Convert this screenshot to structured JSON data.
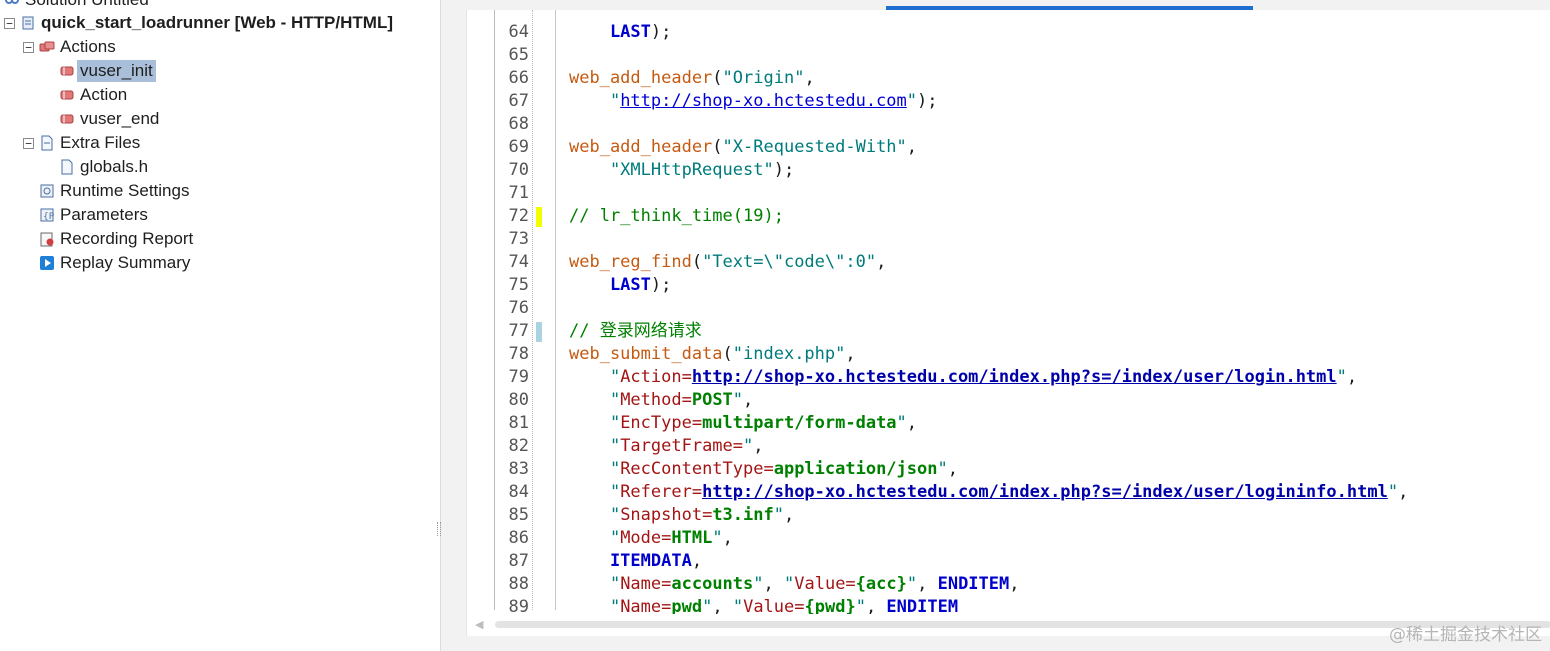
{
  "explorer": {
    "solution_label": "Solution Untitled",
    "script_label": "quick_start_loadrunner [Web - HTTP/HTML]",
    "actions_label": "Actions",
    "vuser_init_label": "vuser_init",
    "action_label": "Action",
    "vuser_end_label": "vuser_end",
    "extra_files_label": "Extra Files",
    "globals_label": "globals.h",
    "runtime_settings_label": "Runtime Settings",
    "parameters_label": "Parameters",
    "recording_report_label": "Recording Report",
    "replay_summary_label": "Replay Summary",
    "toggle_collapse_glyph": "−"
  },
  "editor": {
    "lines": [
      {
        "num": "64",
        "marker": "",
        "segments": [
          {
            "cls": "k-const",
            "text": "    LAST"
          },
          {
            "cls": "k-pun",
            "text": ");"
          }
        ]
      },
      {
        "num": "65",
        "marker": "",
        "segments": []
      },
      {
        "num": "66",
        "marker": "",
        "segments": [
          {
            "cls": "k-fn",
            "text": "web_add_header"
          },
          {
            "cls": "k-pun",
            "text": "("
          },
          {
            "cls": "k-str",
            "text": "\"Origin\""
          },
          {
            "cls": "k-pun",
            "text": ","
          }
        ]
      },
      {
        "num": "67",
        "marker": "",
        "segments": [
          {
            "cls": "k-str",
            "text": "    \""
          },
          {
            "cls": "k-url",
            "text": "http://shop-xo.hctestedu.com"
          },
          {
            "cls": "k-str",
            "text": "\""
          },
          {
            "cls": "k-pun",
            "text": ");"
          }
        ]
      },
      {
        "num": "68",
        "marker": "",
        "segments": []
      },
      {
        "num": "69",
        "marker": "",
        "segments": [
          {
            "cls": "k-fn",
            "text": "web_add_header"
          },
          {
            "cls": "k-pun",
            "text": "("
          },
          {
            "cls": "k-str",
            "text": "\"X-Requested-With\""
          },
          {
            "cls": "k-pun",
            "text": ","
          }
        ]
      },
      {
        "num": "70",
        "marker": "",
        "segments": [
          {
            "cls": "k-str",
            "text": "    \"XMLHttpRequest\""
          },
          {
            "cls": "k-pun",
            "text": ");"
          }
        ]
      },
      {
        "num": "71",
        "marker": "",
        "segments": []
      },
      {
        "num": "72",
        "marker": "#f2ff00",
        "segments": [
          {
            "cls": "k-cmt",
            "text": "// lr_think_time(19);"
          }
        ]
      },
      {
        "num": "73",
        "marker": "",
        "segments": []
      },
      {
        "num": "74",
        "marker": "",
        "segments": [
          {
            "cls": "k-fn",
            "text": "web_reg_find"
          },
          {
            "cls": "k-pun",
            "text": "("
          },
          {
            "cls": "k-str",
            "text": "\"Text=\\\"code\\\":0\""
          },
          {
            "cls": "k-pun",
            "text": ","
          }
        ]
      },
      {
        "num": "75",
        "marker": "",
        "segments": [
          {
            "cls": "k-const",
            "text": "    LAST"
          },
          {
            "cls": "k-pun",
            "text": ");"
          }
        ]
      },
      {
        "num": "76",
        "marker": "",
        "segments": []
      },
      {
        "num": "77",
        "marker": "#a9d3e0",
        "segments": [
          {
            "cls": "k-cmt",
            "text": "// 登录网络请求"
          }
        ]
      },
      {
        "num": "78",
        "marker": "",
        "segments": [
          {
            "cls": "k-fn",
            "text": "web_submit_data"
          },
          {
            "cls": "k-pun",
            "text": "("
          },
          {
            "cls": "k-str",
            "text": "\"index.php\""
          },
          {
            "cls": "k-pun",
            "text": ","
          }
        ]
      },
      {
        "num": "79",
        "marker": "",
        "segments": [
          {
            "cls": "k-str",
            "text": "    \""
          },
          {
            "cls": "k-key",
            "text": "Action="
          },
          {
            "cls": "k-urlb",
            "text": "http://shop-xo.hctestedu.com/index.php?s=/index/user/login.html"
          },
          {
            "cls": "k-str",
            "text": "\""
          },
          {
            "cls": "k-pun",
            "text": ","
          }
        ]
      },
      {
        "num": "80",
        "marker": "",
        "segments": [
          {
            "cls": "k-str",
            "text": "    \""
          },
          {
            "cls": "k-key",
            "text": "Method="
          },
          {
            "cls": "k-val",
            "text": "POST"
          },
          {
            "cls": "k-str",
            "text": "\""
          },
          {
            "cls": "k-pun",
            "text": ","
          }
        ]
      },
      {
        "num": "81",
        "marker": "",
        "segments": [
          {
            "cls": "k-str",
            "text": "    \""
          },
          {
            "cls": "k-key",
            "text": "EncType="
          },
          {
            "cls": "k-val",
            "text": "multipart/form-data"
          },
          {
            "cls": "k-str",
            "text": "\""
          },
          {
            "cls": "k-pun",
            "text": ","
          }
        ]
      },
      {
        "num": "82",
        "marker": "",
        "segments": [
          {
            "cls": "k-str",
            "text": "    \""
          },
          {
            "cls": "k-key",
            "text": "TargetFrame="
          },
          {
            "cls": "k-str",
            "text": "\""
          },
          {
            "cls": "k-pun",
            "text": ","
          }
        ]
      },
      {
        "num": "83",
        "marker": "",
        "segments": [
          {
            "cls": "k-str",
            "text": "    \""
          },
          {
            "cls": "k-key",
            "text": "RecContentType="
          },
          {
            "cls": "k-val",
            "text": "application/json"
          },
          {
            "cls": "k-str",
            "text": "\""
          },
          {
            "cls": "k-pun",
            "text": ","
          }
        ]
      },
      {
        "num": "84",
        "marker": "",
        "segments": [
          {
            "cls": "k-str",
            "text": "    \""
          },
          {
            "cls": "k-key",
            "text": "Referer="
          },
          {
            "cls": "k-urlb",
            "text": "http://shop-xo.hctestedu.com/index.php?s=/index/user/logininfo.html"
          },
          {
            "cls": "k-str",
            "text": "\""
          },
          {
            "cls": "k-pun",
            "text": ","
          }
        ]
      },
      {
        "num": "85",
        "marker": "",
        "segments": [
          {
            "cls": "k-str",
            "text": "    \""
          },
          {
            "cls": "k-key",
            "text": "Snapshot="
          },
          {
            "cls": "k-val",
            "text": "t3.inf"
          },
          {
            "cls": "k-str",
            "text": "\""
          },
          {
            "cls": "k-pun",
            "text": ","
          }
        ]
      },
      {
        "num": "86",
        "marker": "",
        "segments": [
          {
            "cls": "k-str",
            "text": "    \""
          },
          {
            "cls": "k-key",
            "text": "Mode="
          },
          {
            "cls": "k-val",
            "text": "HTML"
          },
          {
            "cls": "k-str",
            "text": "\""
          },
          {
            "cls": "k-pun",
            "text": ","
          }
        ]
      },
      {
        "num": "87",
        "marker": "",
        "segments": [
          {
            "cls": "k-const",
            "text": "    ITEMDATA"
          },
          {
            "cls": "k-pun",
            "text": ","
          }
        ]
      },
      {
        "num": "88",
        "marker": "",
        "segments": [
          {
            "cls": "k-str",
            "text": "    \""
          },
          {
            "cls": "k-key",
            "text": "Name="
          },
          {
            "cls": "k-val",
            "text": "accounts"
          },
          {
            "cls": "k-str",
            "text": "\""
          },
          {
            "cls": "k-pun",
            "text": ", "
          },
          {
            "cls": "k-str",
            "text": "\""
          },
          {
            "cls": "k-key",
            "text": "Value="
          },
          {
            "cls": "k-val",
            "text": "{acc}"
          },
          {
            "cls": "k-str",
            "text": "\""
          },
          {
            "cls": "k-pun",
            "text": ", "
          },
          {
            "cls": "k-const",
            "text": "ENDITEM"
          },
          {
            "cls": "k-pun",
            "text": ","
          }
        ]
      },
      {
        "num": "89",
        "marker": "",
        "segments": [
          {
            "cls": "k-str",
            "text": "    \""
          },
          {
            "cls": "k-key",
            "text": "Name="
          },
          {
            "cls": "k-val",
            "text": "pwd"
          },
          {
            "cls": "k-str",
            "text": "\""
          },
          {
            "cls": "k-pun",
            "text": ", "
          },
          {
            "cls": "k-str",
            "text": "\""
          },
          {
            "cls": "k-key",
            "text": "Value="
          },
          {
            "cls": "k-val",
            "text": "{pwd}"
          },
          {
            "cls": "k-str",
            "text": "\""
          },
          {
            "cls": "k-pun",
            "text": ", "
          },
          {
            "cls": "k-const",
            "text": "ENDITEM"
          }
        ]
      }
    ]
  },
  "scrollbar": {
    "left_arrow_glyph": "◀"
  },
  "watermark": "@稀土掘金技术社区",
  "colors": {
    "selection": "#a9bfd9",
    "tab_indicator": "#1f6fd0",
    "function": "#c55a11",
    "string": "#007b7b",
    "keyword_const": "#0000cc",
    "comment": "#008000"
  }
}
